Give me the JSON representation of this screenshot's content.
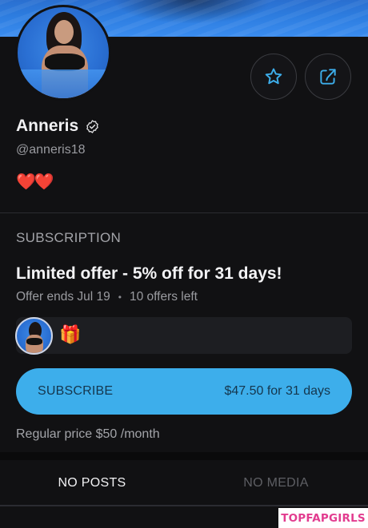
{
  "profile": {
    "name": "Anneris",
    "handle": "@anneris18",
    "bio": "❤️❤️"
  },
  "actions": {
    "favorite_icon": "star-icon",
    "share_icon": "share-icon"
  },
  "subscription": {
    "section_title": "SUBSCRIPTION",
    "offer_title": "Limited offer - 5% off for 31 days!",
    "offer_ends": "Offer ends Jul 19",
    "separator": "•",
    "offers_left": "10 offers left",
    "gift_emoji": "🎁",
    "button_label": "SUBSCRIBE",
    "button_price": "$47.50 for 31 days",
    "regular_price": "Regular price $50 /month"
  },
  "tabs": [
    {
      "label": "NO POSTS",
      "active": true
    },
    {
      "label": "NO MEDIA",
      "active": false
    }
  ],
  "watermark": "TOPFAPGIRLS",
  "colors": {
    "accent": "#3daeeb",
    "background": "#111113",
    "heart": "#e02b2b"
  }
}
